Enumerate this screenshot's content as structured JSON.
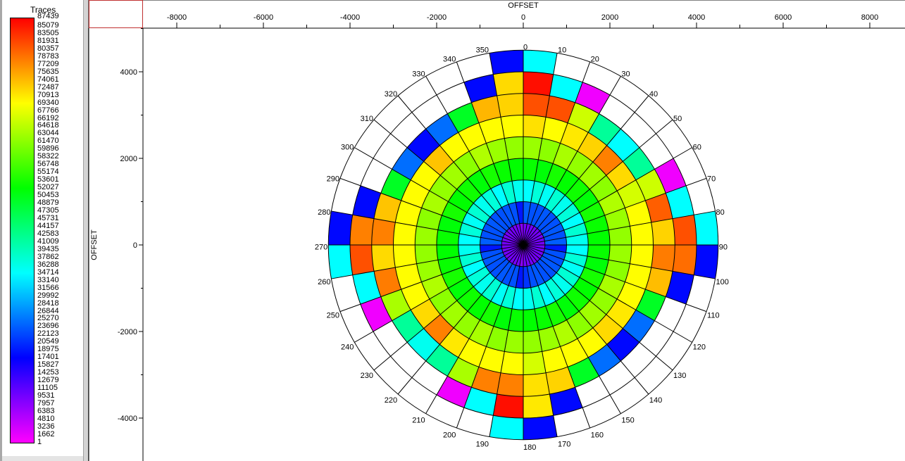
{
  "legend": {
    "title": "Traces",
    "labels": [
      "87439",
      "85079",
      "83505",
      "81931",
      "80357",
      "78783",
      "77209",
      "75635",
      "74061",
      "72487",
      "70913",
      "69340",
      "67766",
      "66192",
      "64618",
      "63044",
      "61470",
      "59896",
      "58322",
      "56748",
      "55174",
      "53601",
      "52027",
      "50453",
      "48879",
      "47305",
      "45731",
      "44157",
      "42583",
      "41009",
      "39435",
      "37862",
      "36288",
      "34714",
      "33140",
      "31566",
      "29992",
      "28418",
      "26844",
      "25270",
      "23696",
      "22123",
      "20549",
      "18975",
      "17401",
      "15827",
      "14253",
      "12679",
      "11105",
      "9531",
      "7957",
      "6383",
      "4810",
      "3236",
      "1662",
      "1"
    ],
    "colormap": [
      {
        "f": 0.0,
        "color": "#ff00ff"
      },
      {
        "f": 0.1,
        "color": "#8000ff"
      },
      {
        "f": 0.2,
        "color": "#0000ff"
      },
      {
        "f": 0.3,
        "color": "#0080ff"
      },
      {
        "f": 0.4,
        "color": "#00ffff"
      },
      {
        "f": 0.5,
        "color": "#00ff80"
      },
      {
        "f": 0.6,
        "color": "#00ff00"
      },
      {
        "f": 0.7,
        "color": "#80ff00"
      },
      {
        "f": 0.8,
        "color": "#ffff00"
      },
      {
        "f": 0.9,
        "color": "#ff8000"
      },
      {
        "f": 1.0,
        "color": "#ff0000"
      }
    ]
  },
  "chart_data": {
    "type": "heatmap",
    "subtype": "polar-rose",
    "xlabel": "OFFSET",
    "ylabel": "OFFSET",
    "value_label": "Traces",
    "value_range": [
      1,
      87439
    ],
    "empty_color": "#ffffff",
    "xlim": [
      -8780,
      8810
    ],
    "ylim": [
      -5000,
      5000
    ],
    "x_ticks": [
      "-8000",
      "-6000",
      "-4000",
      "-2000",
      "0",
      "2000",
      "4000",
      "6000",
      "8000"
    ],
    "x_tick_values": [
      -8000,
      -6000,
      -4000,
      -2000,
      0,
      2000,
      4000,
      6000,
      8000
    ],
    "y_ticks": [
      "4000",
      "2000",
      "0",
      "-2000",
      "-4000"
    ],
    "y_tick_values": [
      4000,
      2000,
      0,
      -2000,
      -4000
    ],
    "ring_edges": [
      0,
      500,
      1000,
      1500,
      2000,
      2500,
      3000,
      3500,
      4000,
      4500
    ],
    "azimuth_step": 10,
    "azimuth_labels": [
      "0",
      "10",
      "20",
      "30",
      "40",
      "50",
      "60",
      "70",
      "80",
      "90",
      "100",
      "110",
      "120",
      "130",
      "140",
      "150",
      "160",
      "170",
      "180",
      "190",
      "200",
      "210",
      "220",
      "230",
      "240",
      "250",
      "260",
      "270",
      "280",
      "290",
      "300",
      "310",
      "320",
      "330",
      "340",
      "350"
    ],
    "values": [
      [
        9500,
        9500,
        9500,
        9500,
        9500,
        9500,
        9500,
        9500,
        9500,
        9500,
        9500,
        9500,
        9500,
        9500,
        9500,
        9500,
        9500,
        9500,
        8000,
        9500,
        9500,
        9500,
        9500,
        9500,
        9500,
        9500,
        9500,
        9500,
        9500,
        9500,
        9500,
        9500,
        9500,
        9500,
        9500,
        8000
      ],
      [
        24000,
        23000,
        23000,
        23500,
        23000,
        23000,
        23500,
        23000,
        24000,
        19000,
        23000,
        23000,
        23500,
        23000,
        23000,
        23500,
        23000,
        21000,
        19000,
        23000,
        23000,
        23500,
        23000,
        23000,
        23500,
        23000,
        19000,
        24000,
        23000,
        23000,
        23500,
        23000,
        23000,
        23500,
        23000,
        19000
      ],
      [
        35000,
        37500,
        35500,
        38000,
        36000,
        37500,
        35000,
        38000,
        36000,
        35000,
        37500,
        35500,
        38000,
        36000,
        37500,
        35000,
        38000,
        36000,
        35000,
        37500,
        35500,
        38000,
        36000,
        37500,
        35000,
        38000,
        36000,
        35000,
        37500,
        35500,
        38000,
        36000,
        37500,
        35000,
        38000,
        36000
      ],
      [
        53000,
        52000,
        54000,
        52500,
        53500,
        52000,
        54000,
        53000,
        52500,
        53000,
        52000,
        54000,
        52500,
        53500,
        52000,
        54000,
        53000,
        52500,
        53000,
        52000,
        54000,
        52500,
        53500,
        52000,
        54000,
        53000,
        52500,
        53000,
        52000,
        54000,
        52500,
        53500,
        52000,
        54000,
        53000,
        52500
      ],
      [
        63000,
        62000,
        64000,
        62500,
        63500,
        62000,
        64500,
        63000,
        62500,
        63000,
        62000,
        64000,
        62500,
        63500,
        62000,
        64500,
        63000,
        62500,
        63000,
        62000,
        64000,
        62500,
        63500,
        62000,
        64500,
        63000,
        62500,
        63000,
        62000,
        64000,
        62500,
        63500,
        62000,
        64500,
        63000,
        62500
      ],
      [
        72000,
        70000,
        71500,
        73000,
        78700,
        72500,
        67000,
        70000,
        70000,
        70000,
        70000,
        70000,
        71500,
        72500,
        70000,
        70000,
        70000,
        67000,
        70000,
        70000,
        70000,
        71500,
        78700,
        72500,
        70000,
        70000,
        70000,
        70000,
        70000,
        70000,
        70000,
        74000,
        70000,
        70000,
        70000,
        70000
      ],
      [
        82000,
        82000,
        66500,
        42000,
        35000,
        42000,
        66500,
        81000,
        73000,
        79000,
        74500,
        50000,
        25000,
        18000,
        25000,
        50000,
        73000,
        72000,
        78700,
        78700,
        64000,
        42000,
        36000,
        42000,
        64000,
        79000,
        72500,
        78700,
        74000,
        50000,
        25000,
        18000,
        25000,
        50000,
        75000,
        73000
      ],
      [
        86500,
        35000,
        1000,
        0,
        0,
        0,
        1000,
        35000,
        82000,
        80000,
        18000,
        0,
        0,
        0,
        0,
        0,
        18000,
        71500,
        86500,
        35000,
        1000,
        0,
        0,
        0,
        1000,
        35000,
        82000,
        78700,
        18000,
        0,
        0,
        0,
        0,
        0,
        18000,
        72500
      ],
      [
        35000,
        0,
        0,
        0,
        0,
        0,
        0,
        0,
        35000,
        18000,
        0,
        0,
        0,
        0,
        0,
        0,
        0,
        18000,
        35000,
        0,
        0,
        0,
        0,
        0,
        0,
        0,
        35000,
        18000,
        0,
        0,
        0,
        0,
        0,
        0,
        0,
        18000
      ]
    ]
  }
}
